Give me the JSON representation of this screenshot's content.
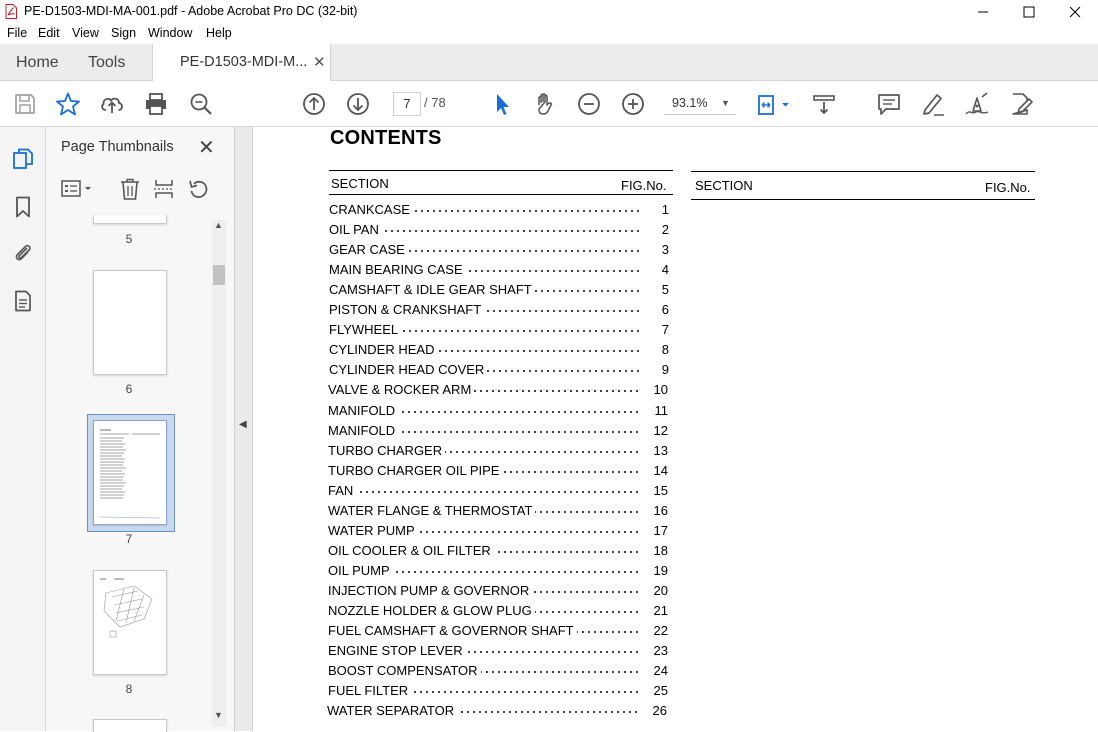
{
  "window": {
    "title": "PE-D1503-MDI-MA-001.pdf - Adobe Acrobat Pro DC (32-bit)"
  },
  "menu": [
    "File",
    "Edit",
    "View",
    "Sign",
    "Window",
    "Help"
  ],
  "tabs": {
    "home": "Home",
    "tools": "Tools",
    "document": "PE-D1503-MDI-M..."
  },
  "toolbar": {
    "current_page": "7",
    "total_pages": "/ 78",
    "zoom": "93.1%"
  },
  "thumbnails": {
    "header": "Page Thumbnails",
    "pages": [
      "5",
      "6",
      "7",
      "8"
    ],
    "selected_page": "7"
  },
  "document": {
    "title": "CONTENTS",
    "left_header": {
      "section": "SECTION",
      "fig": "FIG.No."
    },
    "right_header": {
      "section": "SECTION",
      "fig": "FIG.No."
    },
    "entries": [
      {
        "name": "CRANKCASE",
        "fig": "1"
      },
      {
        "name": "OIL PAN",
        "fig": "2"
      },
      {
        "name": "GEAR CASE",
        "fig": "3"
      },
      {
        "name": "MAIN BEARING CASE",
        "fig": "4"
      },
      {
        "name": "CAMSHAFT & IDLE GEAR SHAFT",
        "fig": "5"
      },
      {
        "name": "PISTON & CRANKSHAFT",
        "fig": "6"
      },
      {
        "name": "FLYWHEEL",
        "fig": "7"
      },
      {
        "name": "CYLINDER HEAD",
        "fig": "8"
      },
      {
        "name": "CYLINDER HEAD COVER",
        "fig": "9"
      },
      {
        "name": "VALVE & ROCKER ARM",
        "fig": "10"
      },
      {
        "name": "MANIFOLD",
        "fig": "11"
      },
      {
        "name": "MANIFOLD",
        "fig": "12"
      },
      {
        "name": "TURBO CHARGER",
        "fig": "13"
      },
      {
        "name": "TURBO CHARGER OIL PIPE",
        "fig": "14"
      },
      {
        "name": "FAN",
        "fig": "15"
      },
      {
        "name": "WATER FLANGE & THERMOSTAT",
        "fig": "16"
      },
      {
        "name": "WATER PUMP",
        "fig": "17"
      },
      {
        "name": "OIL COOLER & OIL FILTER",
        "fig": "18"
      },
      {
        "name": "OIL PUMP",
        "fig": "19"
      },
      {
        "name": "INJECTION PUMP & GOVERNOR",
        "fig": "20"
      },
      {
        "name": "NOZZLE HOLDER & GLOW PLUG",
        "fig": "21"
      },
      {
        "name": "FUEL CAMSHAFT & GOVERNOR SHAFT",
        "fig": "22"
      },
      {
        "name": "ENGINE STOP LEVER",
        "fig": "23"
      },
      {
        "name": "BOOST COMPENSATOR",
        "fig": "24"
      },
      {
        "name": "FUEL FILTER",
        "fig": "25"
      },
      {
        "name": "WATER SEPARATOR",
        "fig": "26"
      }
    ]
  },
  "colors": {
    "accent": "#1a6fd6",
    "icon_gray": "#555555",
    "selection": "#c9d9ef"
  }
}
